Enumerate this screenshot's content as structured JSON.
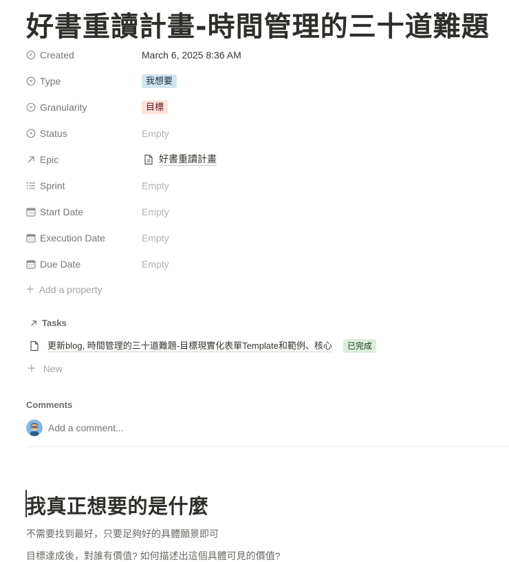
{
  "page": {
    "title": "好書重讀計畫-時間管理的三十道難題"
  },
  "properties": [
    {
      "label": "Created",
      "icon": "clock-icon",
      "value": "March 6, 2025 8:36 AM",
      "kind": "text"
    },
    {
      "label": "Type",
      "icon": "select-icon",
      "value": "我想要",
      "kind": "tag",
      "color": "#d3e5ef"
    },
    {
      "label": "Granularity",
      "icon": "select-icon",
      "value": "目標",
      "kind": "tag",
      "color": "#ffe2dd"
    },
    {
      "label": "Status",
      "icon": "select-icon",
      "value": "Empty",
      "kind": "empty"
    },
    {
      "label": "Epic",
      "icon": "relation-arrow-icon",
      "value": "好書重讀計畫",
      "kind": "link"
    },
    {
      "label": "Sprint",
      "icon": "list-icon",
      "value": "Empty",
      "kind": "empty"
    },
    {
      "label": "Start Date",
      "icon": "calendar-icon",
      "value": "Empty",
      "kind": "empty"
    },
    {
      "label": "Execution Date",
      "icon": "calendar-icon",
      "value": "Empty",
      "kind": "empty"
    },
    {
      "label": "Due Date",
      "icon": "calendar-icon",
      "value": "Empty",
      "kind": "empty"
    }
  ],
  "add_property_label": "Add a property",
  "tasks": {
    "header": "Tasks",
    "items": [
      {
        "title": "更新blog, 時間管理的三十道難題-目標現實化表單Template和範例、核心",
        "status": "已完成",
        "status_color": "#dbeddb"
      }
    ],
    "new_label": "New"
  },
  "comments": {
    "label": "Comments",
    "placeholder": "Add a comment..."
  },
  "body": {
    "heading": "我真正想要的是什麼",
    "paragraphs": [
      "不需要找到最好，只要足夠好的具體願景即可",
      "目標達成後，對誰有價值? 如何描述出這個具體可見的價值?"
    ]
  }
}
